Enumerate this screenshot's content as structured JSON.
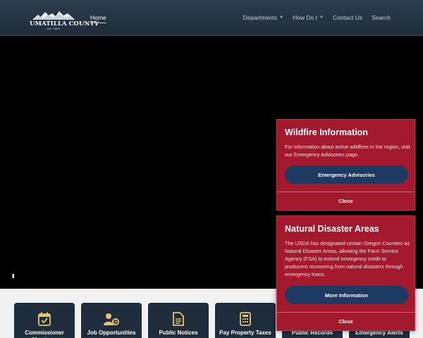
{
  "header": {
    "brand": "UMATILLA COUNTY",
    "est": "est. 1862",
    "nav": {
      "home": "Home",
      "departments": "Departments",
      "how_do_i": "How Do I",
      "contact": "Contact Us",
      "search": "Search"
    }
  },
  "hero": {
    "pause_label": "II"
  },
  "quick_links": [
    {
      "label": "Commissioner Meetings",
      "icon": "calendar-check-icon"
    },
    {
      "label": "Job Opportunities",
      "icon": "users-gear-icon"
    },
    {
      "label": "Public Notices",
      "icon": "document-icon"
    },
    {
      "label": "Pay Property Taxes",
      "icon": "calculator-icon"
    },
    {
      "label": "Public Records",
      "icon": "records-icon"
    },
    {
      "label": "Emergency Alerts",
      "icon": "alert-icon"
    }
  ],
  "alerts": [
    {
      "title": "Wildfire Information",
      "body": "For information about active wildfires in the region, visit our Emergency Advisories page.",
      "button": "Emergency Advisories",
      "close": "Close"
    },
    {
      "title": "Natural Disaster Areas",
      "body": "The USDA has designated certain Oregon Counties as Natural Disaster Areas, allowing the Farm Service Agency (FSA) to extend emergency credit to producers recovering from natural disasters through emergency loans.",
      "button": "More Information",
      "close": "Close"
    }
  ],
  "colors": {
    "header": "#1f2c3a",
    "alert_bg": "#a3192d",
    "button_bg": "#1f3a62",
    "tile_bg": "#1f2c3b"
  }
}
